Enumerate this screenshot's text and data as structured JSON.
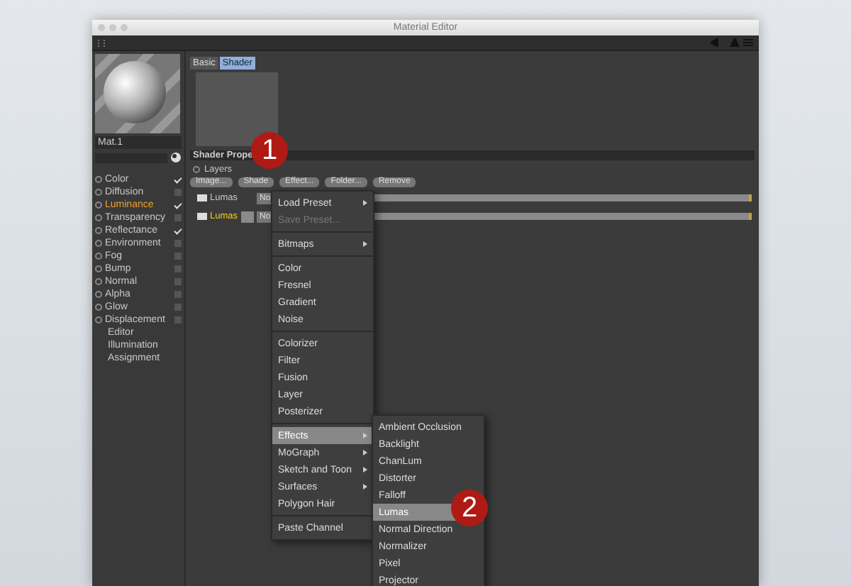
{
  "window": {
    "title": "Material Editor"
  },
  "material": {
    "name": "Mat.1"
  },
  "channels": [
    {
      "label": "Color",
      "kind": "channel",
      "checked": true,
      "selected": false
    },
    {
      "label": "Diffusion",
      "kind": "channel",
      "checked": false,
      "selected": false
    },
    {
      "label": "Luminance",
      "kind": "channel",
      "checked": true,
      "selected": true
    },
    {
      "label": "Transparency",
      "kind": "channel",
      "checked": false,
      "selected": false
    },
    {
      "label": "Reflectance",
      "kind": "channel",
      "checked": true,
      "selected": false
    },
    {
      "label": "Environment",
      "kind": "channel",
      "checked": false,
      "selected": false
    },
    {
      "label": "Fog",
      "kind": "channel",
      "checked": false,
      "selected": false
    },
    {
      "label": "Bump",
      "kind": "channel",
      "checked": false,
      "selected": false
    },
    {
      "label": "Normal",
      "kind": "channel",
      "checked": false,
      "selected": false
    },
    {
      "label": "Alpha",
      "kind": "channel",
      "checked": false,
      "selected": false
    },
    {
      "label": "Glow",
      "kind": "channel",
      "checked": false,
      "selected": false
    },
    {
      "label": "Displacement",
      "kind": "channel",
      "checked": false,
      "selected": false
    },
    {
      "label": "Editor",
      "kind": "page",
      "selected": false
    },
    {
      "label": "Illumination",
      "kind": "page",
      "selected": false
    },
    {
      "label": "Assignment",
      "kind": "page",
      "selected": false
    }
  ],
  "tabs": [
    {
      "label": "Basic",
      "selected": false
    },
    {
      "label": "Shader",
      "selected": true
    }
  ],
  "shader_properties": {
    "title": "Shader Prope",
    "layers_label": "Layers",
    "buttons": [
      "Image...",
      "Shade",
      "Effect...",
      "Folder...",
      "Remove"
    ],
    "layers": [
      {
        "name": "Lumas",
        "mode": "No",
        "selected": false,
        "swatch": false,
        "level": 1
      },
      {
        "name": "Lumas",
        "mode": "No",
        "selected": true,
        "swatch": true,
        "level": 1
      }
    ]
  },
  "menu": {
    "items": [
      {
        "kind": "item",
        "label": "Load Preset",
        "submenu": true,
        "disabled": false,
        "selected": false
      },
      {
        "kind": "item",
        "label": "Save Preset...",
        "submenu": false,
        "disabled": true,
        "selected": false
      },
      {
        "kind": "separator"
      },
      {
        "kind": "item",
        "label": "Bitmaps",
        "submenu": true,
        "disabled": false,
        "selected": false
      },
      {
        "kind": "separator"
      },
      {
        "kind": "item",
        "label": "Color",
        "submenu": false,
        "disabled": false,
        "selected": false
      },
      {
        "kind": "item",
        "label": "Fresnel",
        "submenu": false,
        "disabled": false,
        "selected": false
      },
      {
        "kind": "item",
        "label": "Gradient",
        "submenu": false,
        "disabled": false,
        "selected": false
      },
      {
        "kind": "item",
        "label": "Noise",
        "submenu": false,
        "disabled": false,
        "selected": false
      },
      {
        "kind": "separator"
      },
      {
        "kind": "item",
        "label": "Colorizer",
        "submenu": false,
        "disabled": false,
        "selected": false
      },
      {
        "kind": "item",
        "label": "Filter",
        "submenu": false,
        "disabled": false,
        "selected": false
      },
      {
        "kind": "item",
        "label": "Fusion",
        "submenu": false,
        "disabled": false,
        "selected": false
      },
      {
        "kind": "item",
        "label": "Layer",
        "submenu": false,
        "disabled": false,
        "selected": false
      },
      {
        "kind": "item",
        "label": "Posterizer",
        "submenu": false,
        "disabled": false,
        "selected": false
      },
      {
        "kind": "separator"
      },
      {
        "kind": "item",
        "label": "Effects",
        "submenu": true,
        "disabled": false,
        "selected": true
      },
      {
        "kind": "item",
        "label": "MoGraph",
        "submenu": true,
        "disabled": false,
        "selected": false
      },
      {
        "kind": "item",
        "label": "Sketch and Toon",
        "submenu": true,
        "disabled": false,
        "selected": false
      },
      {
        "kind": "item",
        "label": "Surfaces",
        "submenu": true,
        "disabled": false,
        "selected": false
      },
      {
        "kind": "item",
        "label": "Polygon Hair",
        "submenu": false,
        "disabled": false,
        "selected": false
      },
      {
        "kind": "separator"
      },
      {
        "kind": "item",
        "label": "Paste Channel",
        "submenu": false,
        "disabled": false,
        "selected": false
      }
    ]
  },
  "submenu": {
    "items": [
      {
        "label": "Ambient Occlusion",
        "selected": false
      },
      {
        "label": "Backlight",
        "selected": false
      },
      {
        "label": "ChanLum",
        "selected": false
      },
      {
        "label": "Distorter",
        "selected": false
      },
      {
        "label": "Falloff",
        "selected": false
      },
      {
        "label": "Lumas",
        "selected": true
      },
      {
        "label": "Normal Direction",
        "selected": false
      },
      {
        "label": "Normalizer",
        "selected": false
      },
      {
        "label": "Pixel",
        "selected": false
      },
      {
        "label": "Projector",
        "selected": false
      }
    ]
  },
  "callouts": [
    {
      "label": "1"
    },
    {
      "label": "2"
    }
  ]
}
